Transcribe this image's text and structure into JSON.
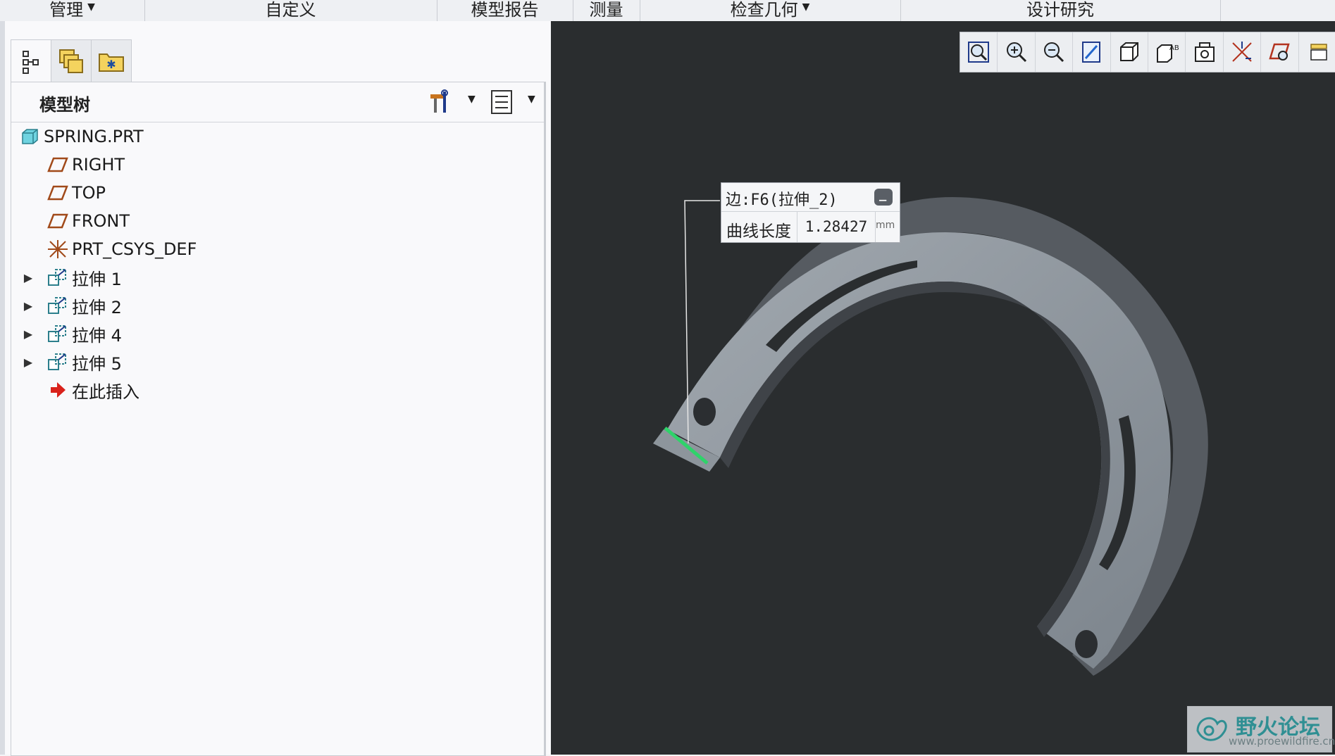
{
  "ribbon": {
    "groups": [
      {
        "label": "管理",
        "caret": "▼"
      },
      {
        "label": "自定义",
        "caret": ""
      },
      {
        "label": "模型报告",
        "caret": ""
      },
      {
        "label": "测量",
        "caret": ""
      },
      {
        "label": "检查几何",
        "caret": "▼"
      },
      {
        "label": "设计研究",
        "caret": ""
      }
    ]
  },
  "sidebar": {
    "tabs": [
      {
        "icon": "model-tree-icon"
      },
      {
        "icon": "layers-icon"
      },
      {
        "icon": "favorites-folder-icon"
      }
    ],
    "tree_title": "模型树",
    "header_icons": [
      "tree-settings-icon",
      "show-options-icon"
    ],
    "caret": "▼",
    "items": [
      {
        "label": "SPRING.PRT",
        "icon": "part-icon",
        "expandable": false
      },
      {
        "label": "RIGHT",
        "icon": "datum-plane-icon",
        "expandable": false
      },
      {
        "label": "TOP",
        "icon": "datum-plane-icon",
        "expandable": false
      },
      {
        "label": "FRONT",
        "icon": "datum-plane-icon",
        "expandable": false
      },
      {
        "label": "PRT_CSYS_DEF",
        "icon": "coordinate-system-icon",
        "expandable": false
      },
      {
        "label": "拉伸 1",
        "icon": "extrude-icon",
        "expandable": true
      },
      {
        "label": "拉伸 2",
        "icon": "extrude-icon",
        "expandable": true
      },
      {
        "label": "拉伸 4",
        "icon": "extrude-icon",
        "expandable": true
      },
      {
        "label": "拉伸 5",
        "icon": "extrude-icon",
        "expandable": true
      },
      {
        "label": "在此插入",
        "icon": "insert-here-arrow-icon",
        "expandable": false
      }
    ],
    "expander_glyph": "▶"
  },
  "viewport": {
    "background": "#2a2d2f",
    "toolbar": [
      "refit-icon",
      "zoom-in-icon",
      "zoom-out-icon",
      "repaint-icon",
      "display-style-icon",
      "saved-orientations-icon",
      "view-manager-icon",
      "datum-display-icon",
      "annotation-display-icon",
      "more-icon"
    ],
    "callout": {
      "title": "边:F6(拉伸_2)",
      "collapse_glyph": "−",
      "measure_label": "曲线长度",
      "measure_value": "1.28427",
      "unit": "mm"
    },
    "highlight_color": "#2fd36a"
  },
  "watermark": {
    "text": "野火论坛",
    "url": "www.proewildfire.cn"
  }
}
